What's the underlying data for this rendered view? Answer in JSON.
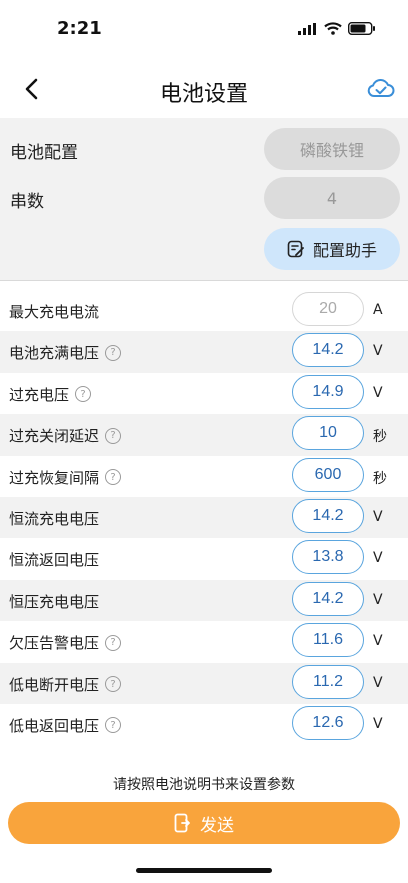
{
  "status": {
    "time": "2:21"
  },
  "nav": {
    "title": "电池设置"
  },
  "battery_config": {
    "type_label": "电池配置",
    "type_value": "磷酸铁锂",
    "series_label": "串数",
    "series_value": "4",
    "assistant_label": "配置助手"
  },
  "params": [
    {
      "label": "最大充电电流",
      "value": "20",
      "unit": "A",
      "help": false,
      "disabled": true
    },
    {
      "label": "电池充满电压",
      "value": "14.2",
      "unit": "V",
      "help": true,
      "disabled": false
    },
    {
      "label": "过充电压",
      "value": "14.9",
      "unit": "V",
      "help": true,
      "disabled": false
    },
    {
      "label": "过充关闭延迟",
      "value": "10",
      "unit": "秒",
      "help": true,
      "disabled": false
    },
    {
      "label": "过充恢复间隔",
      "value": "600",
      "unit": "秒",
      "help": true,
      "disabled": false
    },
    {
      "label": "恒流充电电压",
      "value": "14.2",
      "unit": "V",
      "help": false,
      "disabled": false
    },
    {
      "label": "恒流返回电压",
      "value": "13.8",
      "unit": "V",
      "help": false,
      "disabled": false
    },
    {
      "label": "恒压充电电压",
      "value": "14.2",
      "unit": "V",
      "help": false,
      "disabled": false
    },
    {
      "label": "欠压告警电压",
      "value": "11.6",
      "unit": "V",
      "help": true,
      "disabled": false
    },
    {
      "label": "低电断开电压",
      "value": "11.2",
      "unit": "V",
      "help": true,
      "disabled": false
    },
    {
      "label": "低电返回电压",
      "value": "12.6",
      "unit": "V",
      "help": true,
      "disabled": false
    }
  ],
  "hint": "请按照电池说明书来设置参数",
  "send_label": "发送",
  "colors": {
    "accent": "#5aa5de",
    "send": "#f9a43c",
    "assist_bg": "#cfe6fb",
    "value_text": "#2a68b0"
  }
}
